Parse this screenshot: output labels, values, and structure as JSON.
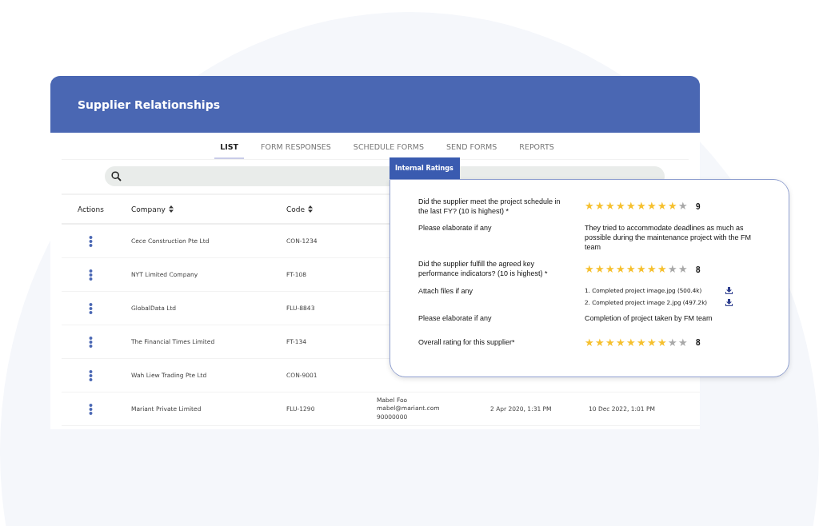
{
  "window": {
    "title": "Supplier Relationships"
  },
  "tabs": [
    {
      "label": "LIST",
      "selected": true
    },
    {
      "label": "FORM RESPONSES",
      "selected": false
    },
    {
      "label": "SCHEDULE FORMS",
      "selected": false
    },
    {
      "label": "SEND FORMS",
      "selected": false
    },
    {
      "label": "REPORTS",
      "selected": false
    }
  ],
  "table": {
    "columns": [
      "Actions",
      "Company",
      "Code"
    ],
    "rows": [
      {
        "company": "Cece Construction Pte Ltd",
        "code": "CON-1234"
      },
      {
        "company": "NYT Limited Company",
        "code": "FT-108"
      },
      {
        "company": "GlobalData Ltd",
        "code": "FLU-8843"
      },
      {
        "company": "The Financial Times Limited",
        "code": "FT-134"
      },
      {
        "company": "Wah Liew Trading Pte Ltd",
        "code": "CON-9001"
      },
      {
        "company": "Mariant Private Limited",
        "code": "FLU-1290",
        "contact": [
          "Mabel Foo",
          "mabel@mariant.com",
          "90000000"
        ],
        "date_1": "2 Apr 2020, 1:31 PM",
        "date_2": "10 Dec 2022, 1:01 PM"
      }
    ]
  },
  "popup": {
    "title": "Internal Ratings",
    "items": [
      {
        "kind": "rating",
        "question": "Did the supplier meet the project schedule in the last FY? (10 is highest) *",
        "stars": 9,
        "score": "9"
      },
      {
        "kind": "text",
        "question": "Please elaborate if any",
        "answer": "They tried to accommodate deadlines as much as possible during the maintenance project with the FM team"
      },
      {
        "kind": "rating",
        "question": "Did the supplier fulfill the agreed key performance indicators? (10 is highest) *",
        "stars": 8,
        "score": "8"
      },
      {
        "kind": "files",
        "question": "Attach files if any",
        "files": [
          "1. Completed project image.jpg (500.4k)",
          "2. Completed project image 2.jpg (497.2k)"
        ]
      },
      {
        "kind": "text",
        "question": "Please elaborate if any",
        "answer": "Completion of project taken by FM team"
      },
      {
        "kind": "rating",
        "question": "Overall rating for this supplier*",
        "stars": 8,
        "score": "8"
      }
    ]
  }
}
